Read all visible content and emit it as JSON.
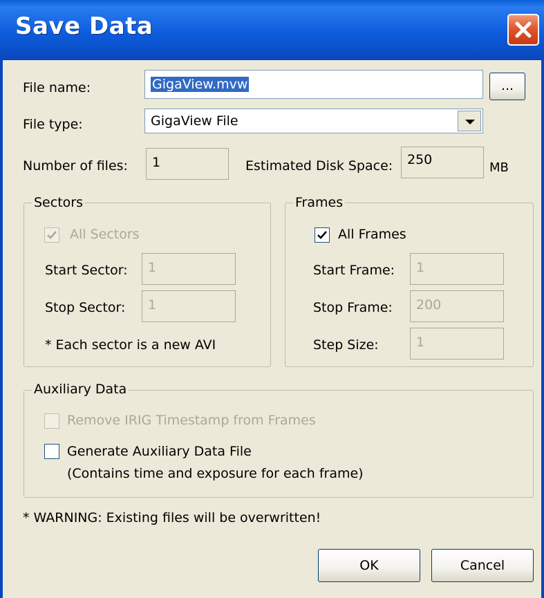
{
  "window": {
    "title": "Save Data"
  },
  "file_name": {
    "label": "File name:",
    "value": "GigaView.mvw",
    "browse_label": "..."
  },
  "file_type": {
    "label": "File type:",
    "value": "GigaView File"
  },
  "number_of_files": {
    "label": "Number of files:",
    "value": "1"
  },
  "disk_space": {
    "label": "Estimated Disk Space:",
    "value": "250",
    "unit": "MB"
  },
  "sectors": {
    "title": "Sectors",
    "all_label": "All Sectors",
    "all_checked": true,
    "start_label": "Start Sector:",
    "start_value": "1",
    "stop_label": "Stop Sector:",
    "stop_value": "1",
    "note": "* Each sector is a new AVI"
  },
  "frames": {
    "title": "Frames",
    "all_label": "All Frames",
    "all_checked": true,
    "start_label": "Start Frame:",
    "start_value": "1",
    "stop_label": "Stop Frame:",
    "stop_value": "200",
    "step_label": "Step Size:",
    "step_value": "1"
  },
  "auxiliary": {
    "title": "Auxiliary Data",
    "remove_irig_label": "Remove IRIG Timestamp from Frames",
    "remove_irig_checked": false,
    "generate_label": "Generate Auxiliary Data File",
    "generate_checked": false,
    "generate_note": "(Contains time and exposure for each frame)"
  },
  "warning": "* WARNING: Existing files will be overwritten!",
  "buttons": {
    "ok": "OK",
    "cancel": "Cancel"
  }
}
